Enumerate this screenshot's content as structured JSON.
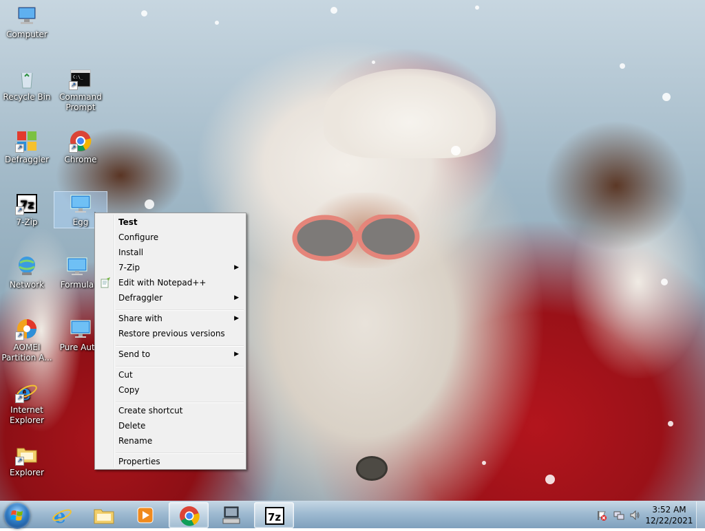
{
  "desktop_icons": [
    {
      "label": "Computer",
      "icon": "computer-icon"
    },
    {
      "label": "Recycle Bin",
      "icon": "recycle-bin-icon"
    },
    {
      "label": "Command Prompt",
      "icon": "command-prompt-icon"
    },
    {
      "label": "Defraggler",
      "icon": "defraggler-icon"
    },
    {
      "label": "Chrome",
      "icon": "chrome-icon"
    },
    {
      "label": "7-Zip",
      "icon": "7zip-icon"
    },
    {
      "label": "Egg",
      "icon": "monitor-icon",
      "selected": true
    },
    {
      "label": "Network",
      "icon": "network-icon"
    },
    {
      "label": "Formula",
      "icon": "monitor-icon"
    },
    {
      "label": "AOMEI Partition A...",
      "icon": "aomei-icon"
    },
    {
      "label": "Pure Autis",
      "icon": "monitor-icon"
    },
    {
      "label": "Internet Explorer",
      "icon": "internet-explorer-icon"
    },
    {
      "label": "Explorer",
      "icon": "explorer-folder-icon"
    }
  ],
  "context_menu": {
    "items": [
      {
        "label": "Test",
        "bold": true
      },
      {
        "label": "Configure"
      },
      {
        "label": "Install"
      },
      {
        "label": "7-Zip",
        "submenu": true
      },
      {
        "label": "Edit with Notepad++",
        "icon": "notepad-plus-plus-icon"
      },
      {
        "label": "Defraggler",
        "submenu": true
      },
      {
        "label": "Share with",
        "submenu": true
      },
      {
        "label": "Restore previous versions"
      },
      {
        "label": "Send to",
        "submenu": true
      },
      {
        "label": "Cut"
      },
      {
        "label": "Copy"
      },
      {
        "label": "Create shortcut"
      },
      {
        "label": "Delete"
      },
      {
        "label": "Rename"
      },
      {
        "label": "Properties"
      }
    ],
    "submenu_arrow": "▶"
  },
  "taskbar": {
    "start_button": "start-orb-icon",
    "pinned": [
      {
        "name": "Internet Explorer",
        "icon": "internet-explorer-icon"
      },
      {
        "name": "Windows Explorer",
        "icon": "explorer-folder-icon"
      },
      {
        "name": "Windows Media Player",
        "icon": "media-player-icon"
      },
      {
        "name": "Chrome",
        "icon": "chrome-icon",
        "open": true
      },
      {
        "name": "Control Panel",
        "icon": "computer-monitor-icon"
      },
      {
        "name": "7-Zip",
        "icon": "7zip-icon",
        "open": true
      }
    ],
    "tray": [
      "action-center-flag-icon",
      "network-icon",
      "speaker-icon"
    ],
    "clock": {
      "time": "3:52 AM",
      "date": "12/22/2021"
    }
  }
}
